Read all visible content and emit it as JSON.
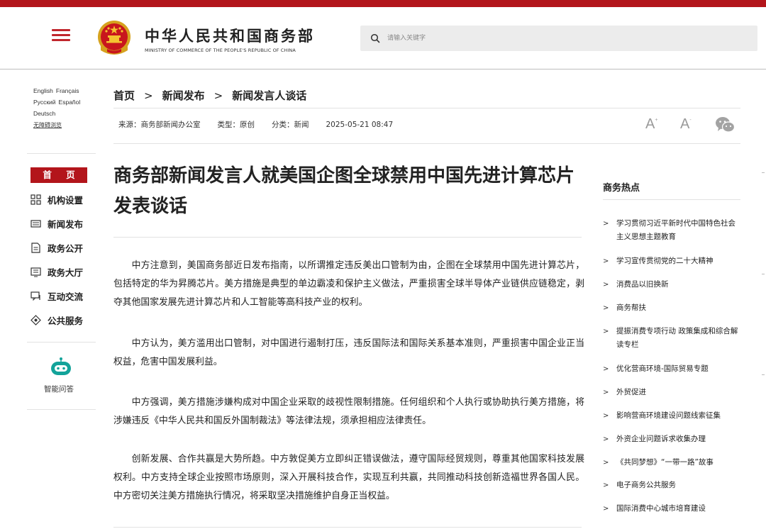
{
  "header": {
    "title": "中华人民共和国商务部",
    "subtitle": "MINISTRY OF COMMERCE OF THE PEOPLE'S REPUBLIC OF CHINA",
    "search_placeholder": "请输入关键字"
  },
  "languages": {
    "english": "English",
    "francais": "Français",
    "russian": "Русский",
    "espanol": "Español",
    "deutsch": "Deutsch",
    "accessibility": "无障碍浏览"
  },
  "nav": {
    "home": "首 页",
    "items": [
      {
        "label": "机构设置",
        "icon": "org-grid-icon"
      },
      {
        "label": "新闻发布",
        "icon": "news-icon"
      },
      {
        "label": "政务公开",
        "icon": "document-icon"
      },
      {
        "label": "政务大厅",
        "icon": "service-hall-icon"
      },
      {
        "label": "互动交流",
        "icon": "interaction-icon"
      },
      {
        "label": "公共服务",
        "icon": "public-service-icon"
      }
    ],
    "assistant_label": "智能问答"
  },
  "breadcrumb": {
    "home": "首页",
    "news": "新闻发布",
    "current": "新闻发言人谈话",
    "sep": ">"
  },
  "meta": {
    "source": "来源：商务部新闻办公室",
    "type": "类型：原创",
    "category": "分类：新闻",
    "date": "2025-05-21 08:47"
  },
  "article": {
    "title": "商务部新闻发言人就美国企图全球禁用中国先进计算芯片发表谈话",
    "paragraphs": [
      "中方注意到，美国商务部近日发布指南，以所谓推定违反美出口管制为由，企图在全球禁用中国先进计算芯片，包括特定的华为昇腾芯片。美方措施是典型的单边霸凌和保护主义做法，严重损害全球半导体产业链供应链稳定，剥夺其他国家发展先进计算芯片和人工智能等高科技产业的权利。",
      "中方认为，美方滥用出口管制，对中国进行遏制打压，违反国际法和国际关系基本准则，严重损害中国企业正当权益，危害中国发展利益。",
      "中方强调，美方措施涉嫌构成对中国企业采取的歧视性限制措施。任何组织和个人执行或协助执行美方措施，将涉嫌违反《中华人民共和国反外国制裁法》等法律法规，须承担相应法律责任。",
      "创新发展、合作共赢是大势所趋。中方敦促美方立即纠正错误做法，遵守国际经贸规则，尊重其他国家科技发展权利。中方支持全球企业按照市场原则，深入开展科技合作，实现互利共赢，共同推动科技创新造福世界各国人民。中方密切关注美方措施执行情况，将采取坚决措施维护自身正当权益。"
    ]
  },
  "tools": {
    "font_large": "A",
    "font_small": "A"
  },
  "hot": {
    "title": "商务热点",
    "arrow": ">",
    "items": [
      "学习贯彻习近平新时代中国特色社会主义思想主题教育",
      "学习宣传贯彻党的二十大精神",
      "消费品以旧换新",
      "商务帮扶",
      "提振消费专项行动 政策集成和综合解读专栏",
      "优化营商环境-国际贸易专题",
      "外贸促进",
      "影响营商环境建设问题线索征集",
      "外资企业问题诉求收集办理",
      "《共同梦想》“一带一路”故事",
      "电子商务公共服务",
      "国际消费中心城市培育建设"
    ]
  },
  "colors": {
    "brand_red": "#b3151b",
    "accent_teal": "#13a39a"
  }
}
